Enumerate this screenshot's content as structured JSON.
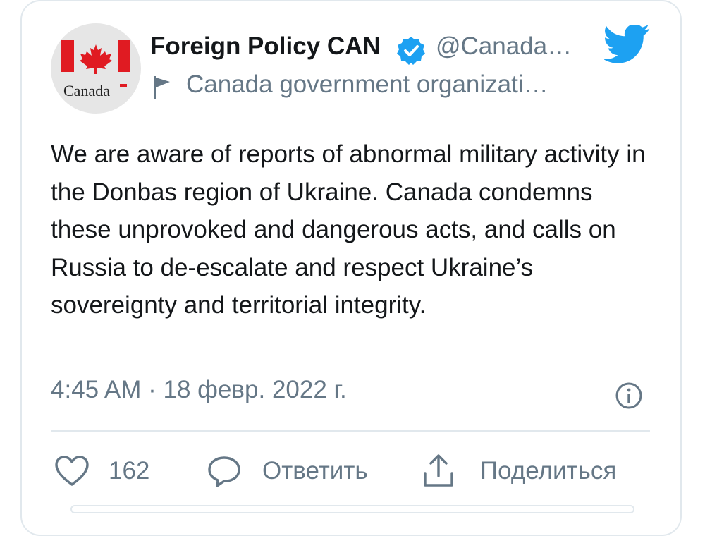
{
  "tweet": {
    "author_name": "Foreign Policy CAN",
    "handle": "@Canada…",
    "org_label": "Canada government organizati…",
    "avatar_wordmark": "Canada",
    "text": "We are aware of reports of abnormal military activity in the Donbas region of Ukraine. Canada condemns these unprovoked and dangerous acts, and calls on Russia to de-escalate and respect Ukraine’s sovereignty and territorial integrity.",
    "timestamp": "4:45 AM · 18 февр. 2022 г."
  },
  "actions": {
    "like_count": "162",
    "reply_label": "Ответить",
    "share_label": "Поделиться"
  },
  "icons": {
    "verified": "verified-badge-icon",
    "twitter": "twitter-bird-icon",
    "flag": "flag-icon",
    "info": "info-icon",
    "like": "heart-icon",
    "reply": "speech-bubble-icon",
    "share": "share-upload-icon"
  },
  "colors": {
    "twitter_blue": "#1da1f2",
    "flag_red": "#e01b22",
    "text_primary": "#14171a",
    "text_secondary": "#657786"
  }
}
